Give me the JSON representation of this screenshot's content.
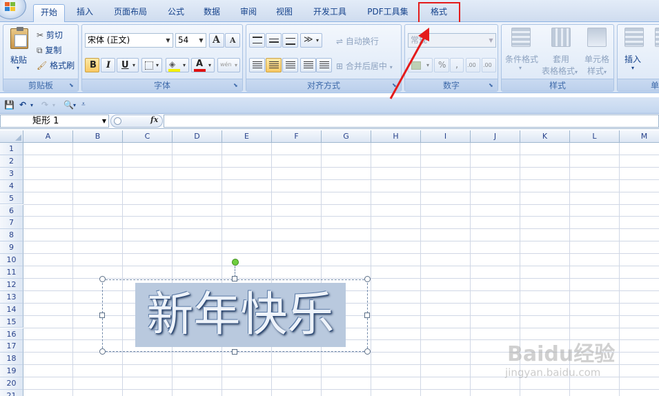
{
  "tabs": [
    {
      "label": "开始",
      "active": true
    },
    {
      "label": "插入"
    },
    {
      "label": "页面布局"
    },
    {
      "label": "公式"
    },
    {
      "label": "数据"
    },
    {
      "label": "审阅"
    },
    {
      "label": "视图"
    },
    {
      "label": "开发工具"
    },
    {
      "label": "PDF工具集"
    },
    {
      "label": "格式",
      "highlighted": true
    }
  ],
  "clipboard": {
    "label": "剪贴板",
    "paste": "粘贴",
    "cut": "剪切",
    "copy": "复制",
    "format_painter": "格式刷"
  },
  "font": {
    "label": "字体",
    "name": "宋体 (正文)",
    "size": "54",
    "bold": "B",
    "italic": "I",
    "underline": "U",
    "grow": "A",
    "shrink": "A",
    "color_a": "A",
    "phonetic": "wén"
  },
  "alignment": {
    "label": "对齐方式",
    "wrap": "自动换行",
    "merge": "合并后居中"
  },
  "number": {
    "label": "数字",
    "format": "常规",
    "percent": "%",
    "comma": ",",
    "inc_dec": ".00",
    "dec_dec": ".00"
  },
  "styles": {
    "label": "样式",
    "conditional": "条件格式",
    "table_line1": "套用",
    "table_line2": "表格格式",
    "cell_line1": "单元格",
    "cell_line2": "样式"
  },
  "cells": {
    "label": "单",
    "insert": "插入"
  },
  "formula_bar": {
    "name_box": "矩形 1",
    "fx": "fx"
  },
  "columns": [
    "A",
    "B",
    "C",
    "D",
    "E",
    "F",
    "G",
    "H",
    "I",
    "J",
    "K",
    "L",
    "M"
  ],
  "rows": [
    "1",
    "2",
    "3",
    "4",
    "5",
    "6",
    "7",
    "8",
    "9",
    "10",
    "11",
    "12",
    "13",
    "14",
    "15",
    "16",
    "17",
    "18",
    "19",
    "20",
    "21"
  ],
  "shape": {
    "text": "新年快乐"
  },
  "watermark": {
    "brand": "Baidu经验",
    "url": "jingyan.baidu.com"
  },
  "colors": {
    "accent_red": "#e41b1b",
    "ribbon_blue": "#15428b"
  }
}
